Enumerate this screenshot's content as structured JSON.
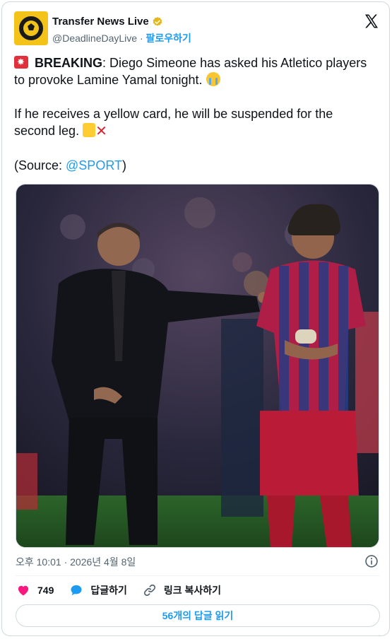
{
  "account": {
    "name": "Transfer News Live",
    "handle": "@DeadlineDayLive",
    "separator": "·",
    "follow_label": "팔로우하기"
  },
  "tweet": {
    "breaking": "BREAKING",
    "line1_rest": ": Diego Simeone has asked his Atletico players to provoke Lamine Yamal tonight.",
    "line2": "If he receives a yellow card, he will be suspended for the second leg.",
    "source_prefix": "(Source: ",
    "source_link": "@SPORT",
    "source_suffix": ")"
  },
  "meta": {
    "timestamp": "오후 10:01 · 2026년 4월 8일"
  },
  "actions": {
    "like_count": "749",
    "reply_label": "답글하기",
    "copy_link_label": "링크 복사하기"
  },
  "read_replies_label": "56개의 답글 읽기",
  "colors": {
    "accent": "#1d9bf0",
    "like": "#f91880",
    "avatar_bg": "#f3c319"
  },
  "icons": {
    "verified": "verified-badge-icon",
    "x_logo": "x-logo-icon",
    "info": "info-icon",
    "heart": "heart-icon",
    "reply": "reply-bubble-icon",
    "link": "link-icon"
  }
}
